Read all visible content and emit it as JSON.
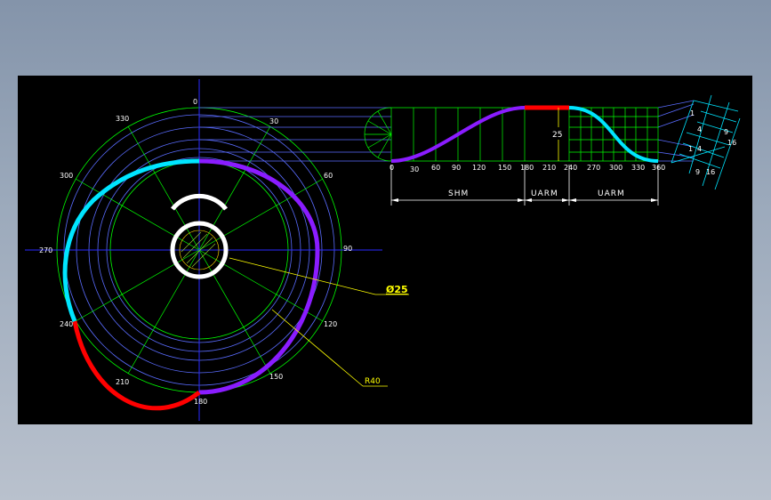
{
  "drawing": {
    "cam_angle_labels": {
      "a0": "0",
      "a30": "30",
      "a60": "60",
      "a90": "90",
      "a120": "120",
      "a150": "150",
      "a180": "180",
      "a210": "210",
      "a240": "240",
      "a270": "270",
      "a300": "300",
      "a330": "330"
    },
    "diagram_axis_labels": [
      "0",
      "30",
      "60",
      "90",
      "120",
      "150",
      "180",
      "210",
      "240",
      "270",
      "300",
      "330",
      "360"
    ],
    "segments": {
      "shm": "SHM",
      "uarm1": "UARM",
      "uarm2": "UARM"
    },
    "dims": {
      "rise": "25",
      "hole_diameter": "Ø25",
      "base_radius": "R40",
      "side_a": "1",
      "side_b": "4",
      "side_c": "9",
      "side_d": "16",
      "side_e": "1",
      "side_f": "4",
      "side_g": "9",
      "side_h": "16"
    },
    "colors": {
      "background": "#000000",
      "grid": "#00ff00",
      "construction": "#5a6cff",
      "axis": "#2a2aff",
      "shm_curve": "#8a1cff",
      "dwell_curve": "#ff0000",
      "uarm_curve": "#00e5ff",
      "hub": "#ffffff",
      "annotation": "#ffff00"
    }
  }
}
